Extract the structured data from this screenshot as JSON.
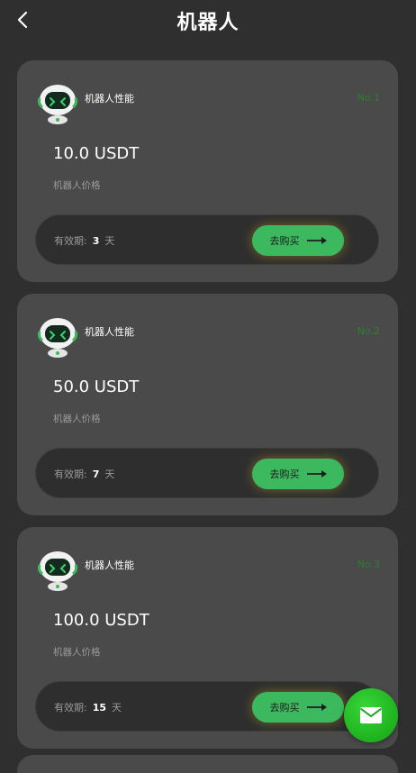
{
  "header": {
    "title": "机器人"
  },
  "cards": [
    {
      "perf_label": "机器人性能",
      "no": "No.1",
      "price": "10.0 USDT",
      "price_label": "机器人价格",
      "validity_label": "有效期:",
      "days": "3",
      "days_unit": "天",
      "buy_label": "去购买"
    },
    {
      "perf_label": "机器人性能",
      "no": "No.2",
      "price": "50.0 USDT",
      "price_label": "机器人价格",
      "validity_label": "有效期:",
      "days": "7",
      "days_unit": "天",
      "buy_label": "去购买"
    },
    {
      "perf_label": "机器人性能",
      "no": "No.3",
      "price": "100.0 USDT",
      "price_label": "机器人价格",
      "validity_label": "有效期:",
      "days": "15",
      "days_unit": "天",
      "buy_label": "去购买"
    }
  ],
  "icons": {
    "back": "chevron-left-icon",
    "robot": "robot-icon",
    "arrow": "arrow-right-icon",
    "fab": "mail-icon"
  },
  "colors": {
    "background": "#2f2f2f",
    "card": "#4a4a4a",
    "accent": "#3cb95f",
    "number": "#2e7d32",
    "fab": "#1fb81f"
  }
}
